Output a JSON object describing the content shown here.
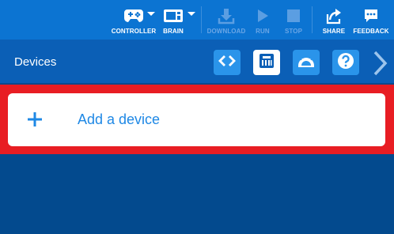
{
  "toolbar": {
    "controller_label": "CONTROLLER",
    "brain_label": "BRAIN",
    "download_label": "DOWNLOAD",
    "run_label": "RUN",
    "stop_label": "STOP",
    "share_label": "SHARE",
    "feedback_label": "FEEDBACK"
  },
  "header": {
    "title": "Devices",
    "buttons": [
      {
        "icon": "code-icon",
        "active": false
      },
      {
        "icon": "device-port-icon",
        "active": true
      },
      {
        "icon": "dashboard-gauge-icon",
        "active": false
      },
      {
        "icon": "help-icon",
        "active": false
      }
    ],
    "next_icon": "chevron-right-icon"
  },
  "main": {
    "add_device_label": "Add a device",
    "add_icon": "plus-icon"
  },
  "colors": {
    "toolbar_bg": "#0c74d2",
    "header_bg": "#0b5fb6",
    "page_bg": "#034a8e",
    "highlight_frame": "#e81d23",
    "accent": "#1e88e5"
  }
}
